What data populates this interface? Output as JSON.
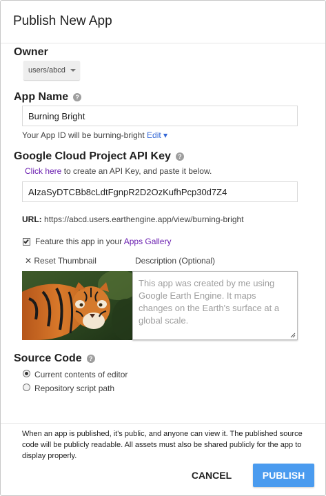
{
  "dialog": {
    "title": "Publish New App"
  },
  "owner": {
    "label": "Owner",
    "selected": "users/abcd"
  },
  "app_name": {
    "label": "App Name",
    "value": "Burning Bright",
    "app_id_text": "Your App ID will be burning-bright",
    "edit_link": "Edit ▾"
  },
  "api_key": {
    "label": "Google Cloud Project API Key",
    "click_here": "Click here",
    "instructions": " to create an API Key, and paste it below.",
    "value": "AIzaSyDTCBb8cLdtFgnpR2D2OzKufhPcp30d7Z4"
  },
  "url": {
    "label": "URL:",
    "value": "https://abcd.users.earthengine.app/view/burning-bright"
  },
  "feature": {
    "checked": true,
    "text": "Feature this app in your ",
    "link": "Apps Gallery"
  },
  "thumbnail": {
    "reset_label": "✕ Reset Thumbnail"
  },
  "description": {
    "label": "Description (Optional)",
    "placeholder": "This app was created by me using Google Earth Engine. It maps changes on the Earth's surface at a global scale."
  },
  "source_code": {
    "label": "Source Code",
    "options": [
      {
        "label": "Current contents of editor",
        "checked": true
      },
      {
        "label": "Repository script path",
        "checked": false
      }
    ]
  },
  "footer": {
    "notice": "When an app is published, it's public, and anyone can view it. The published source code will be publicly readable. All assets must also be shared publicly for the app to display properly.",
    "cancel_label": "CANCEL",
    "publish_label": "PUBLISH"
  },
  "colors": {
    "accent": "#4a9bef",
    "link": "#3367d6",
    "link_purple": "#6a1fb0"
  }
}
